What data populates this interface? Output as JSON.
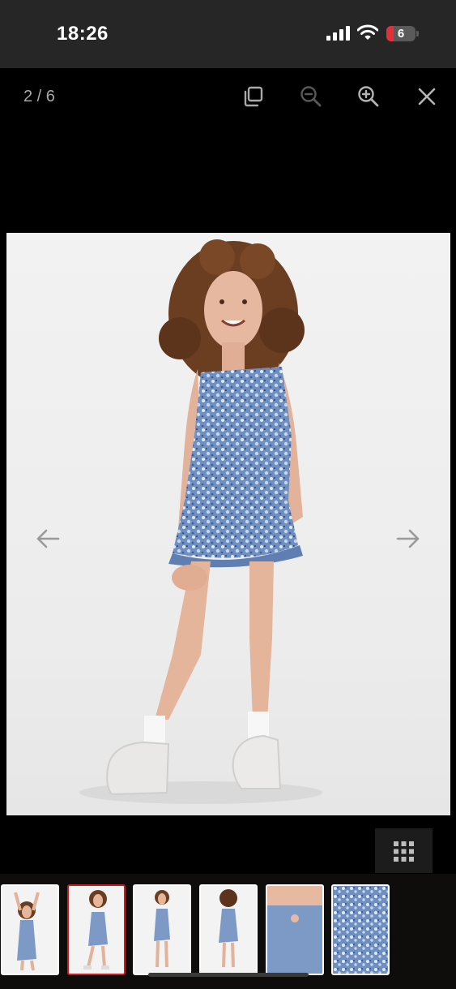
{
  "status_bar": {
    "time": "18:26",
    "battery_level": "6",
    "battery_color": "#e0313b",
    "icons": [
      "signal-icon",
      "wifi-icon",
      "battery-icon"
    ]
  },
  "gallery": {
    "counter": "2 / 6",
    "toolbar_icons": [
      "copy-icon",
      "zoom-out-icon",
      "zoom-in-icon",
      "close-icon"
    ],
    "nav_icons": [
      "arrow-left-icon",
      "arrow-right-icon"
    ],
    "grid_icon": "grid-icon",
    "current_index": 2,
    "total": 6,
    "accent_color": "#cc1b1b",
    "thumbnails": [
      {
        "view": "model-front-arms-up"
      },
      {
        "view": "model-front-smiling"
      },
      {
        "view": "model-front-full"
      },
      {
        "view": "model-back"
      },
      {
        "view": "dress-detail-closeup"
      },
      {
        "view": "fabric-pattern"
      }
    ]
  }
}
